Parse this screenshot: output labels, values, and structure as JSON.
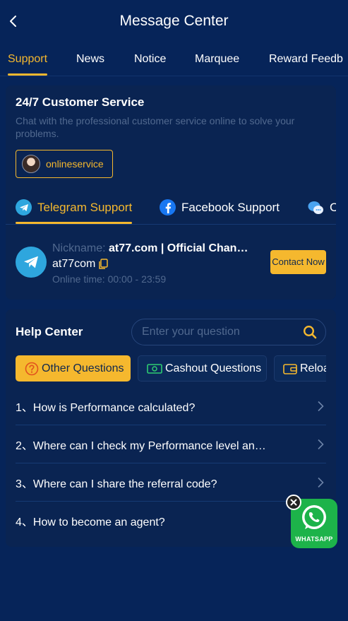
{
  "header": {
    "title": "Message Center"
  },
  "tabs": [
    {
      "label": "Support",
      "active": true
    },
    {
      "label": "News"
    },
    {
      "label": "Notice"
    },
    {
      "label": "Marquee"
    },
    {
      "label": "Reward Feedb"
    }
  ],
  "customer_service": {
    "title": "24/7 Customer Service",
    "description": "Chat with the professional customer service online to solve your problems.",
    "online_button": "onlineservice",
    "channels": [
      {
        "label": "Telegram Support",
        "icon": "telegram-icon",
        "active": true
      },
      {
        "label": "Facebook Support",
        "icon": "facebook-icon"
      },
      {
        "label": "C",
        "icon": "chat-icon"
      }
    ],
    "contact": {
      "nickname_label": "Nickname:",
      "nickname": "at77.com | Official Chan…",
      "account": "at77com",
      "online_time_label": "Online time:",
      "online_time": "00:00 - 23:59",
      "button": "Contact Now"
    }
  },
  "help_center": {
    "title": "Help Center",
    "search_placeholder": "Enter your question",
    "categories": [
      {
        "label": "Other Questions",
        "icon": "question-icon",
        "active": true
      },
      {
        "label": "Cashout Questions",
        "icon": "cash-icon"
      },
      {
        "label": "Reloa",
        "icon": "wallet-icon"
      }
    ],
    "questions": [
      {
        "label": "1、How is Performance calculated?"
      },
      {
        "label": "2、Where can I check my Performance level an…"
      },
      {
        "label": "3、Where can I share the referral code?"
      },
      {
        "label": "4、How to become an agent?"
      }
    ]
  },
  "whatsapp": {
    "label": "WHATSAPP"
  },
  "colors": {
    "background": "#062459",
    "card": "#0a2452",
    "accent": "#f5b82e",
    "muted": "#51698f"
  }
}
